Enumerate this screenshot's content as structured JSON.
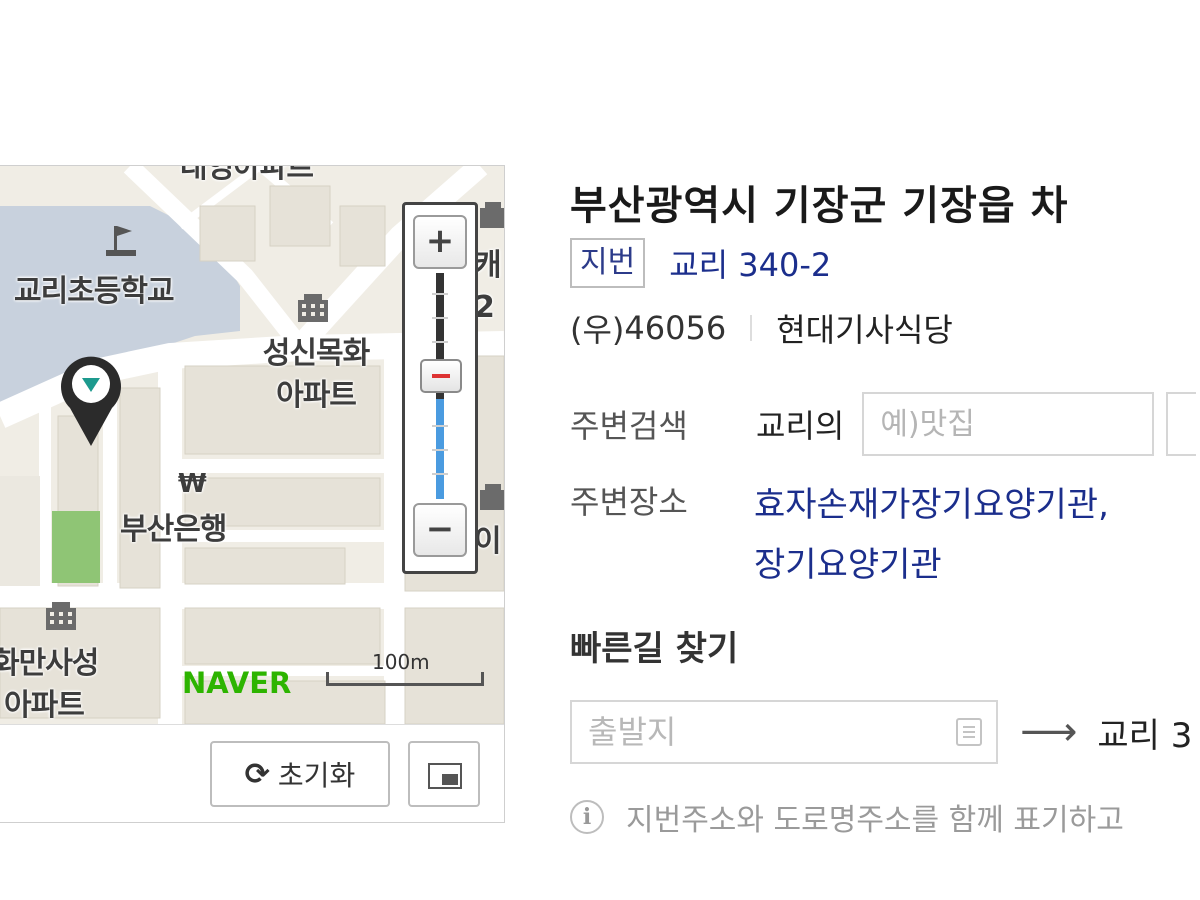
{
  "map": {
    "labels": {
      "top_apartment": "대영아파트",
      "school": "교리초등학교",
      "seongsin_line1": "성신목화",
      "seongsin_line2": "아파트",
      "bank": "부산은행",
      "left_apartment_line1": "화만사성",
      "left_apartment_line2": "아파트",
      "right_partial_1": "캐",
      "right_partial_2": "2",
      "right_partial_3": "이"
    },
    "won_symbol": "₩",
    "logo": "NAVER",
    "scale": "100m",
    "zoom": {
      "in": "+",
      "out": "−"
    },
    "reset_label": "초기화",
    "colors": {
      "road": "#ffffff",
      "ground": "#f0ede5",
      "school_area": "#c8d1dd",
      "park": "#8fc575",
      "zoom_level": "#4a9be0",
      "naver_green": "#2db400"
    }
  },
  "info": {
    "title": "부산광역시 기장군 기장읍 차",
    "jibun_badge": "지번",
    "jibun_address": "교리 340-2",
    "postal_prefix": "(우)",
    "postal_code": "46056",
    "building": "현대기사식당",
    "nearby_search_label": "주변검색",
    "nearby_prefix": "교리의",
    "nearby_placeholder": "예)맛집",
    "nearby_places_label": "주변장소",
    "place_1": "효자손재가장기요양기관,",
    "place_2": "장기요양기관",
    "route_title": "빠른길 찾기",
    "origin_placeholder": "출발지",
    "arrow": "⟶",
    "destination": "교리 3",
    "notice": "지번주소와 도로명주소를 함께 표기하고"
  }
}
